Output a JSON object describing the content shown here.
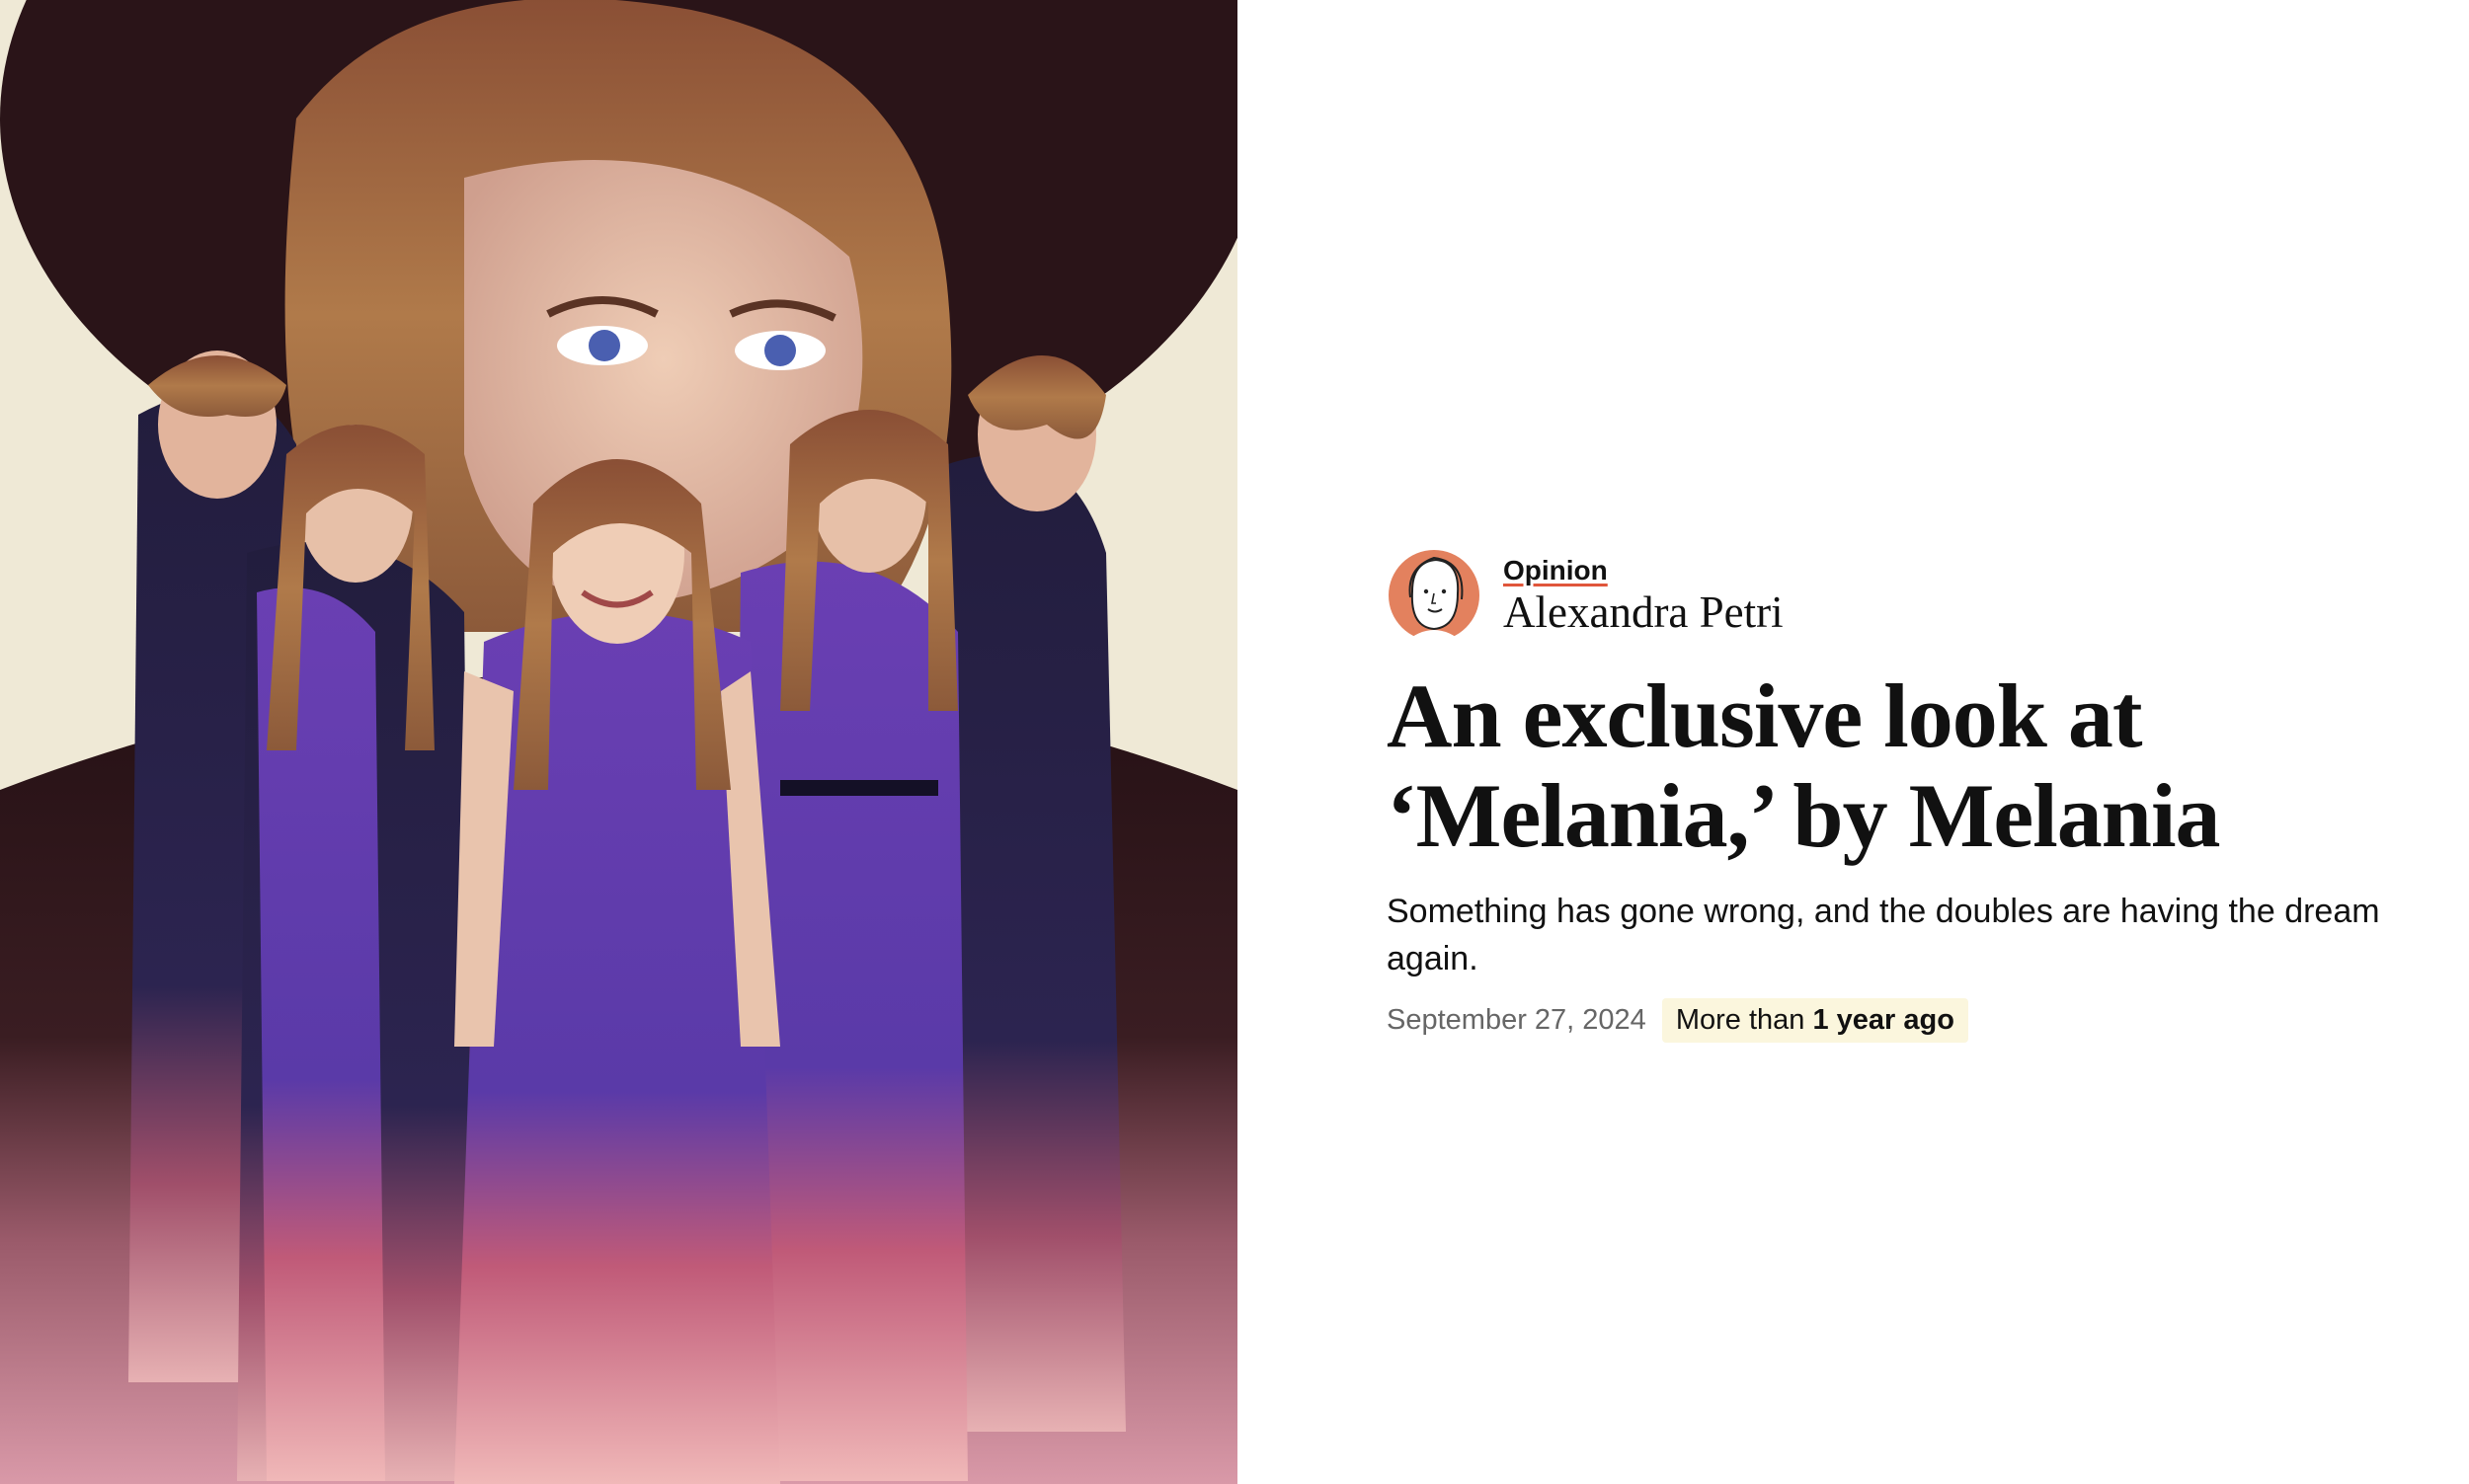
{
  "illustration": {
    "icon": "illustration-women-figures"
  },
  "byline": {
    "section": "Opinion",
    "author": "Alexandra Petri",
    "avatar_icon": "author-portrait-icon",
    "avatar_color": "#e3815e"
  },
  "headline": {
    "line1": "An exclusive look at",
    "line2": "‘Melania,’ by Melania"
  },
  "dek": "Something has gone wrong, and the doubles are having the dream again.",
  "meta": {
    "date": "September 27, 2024",
    "recency_prefix": "More than",
    "recency_emphasis": "1 year ago",
    "recency_bg": "#fbf6dd"
  },
  "colors": {
    "dress_purple": "#6a3fb3",
    "jacket_navy": "#1f1b3a",
    "hair_brown": "#a06a3e",
    "background_cream": "#efe9d6",
    "background_dark": "#2a1418",
    "gradient_pink": "#d9869a"
  }
}
